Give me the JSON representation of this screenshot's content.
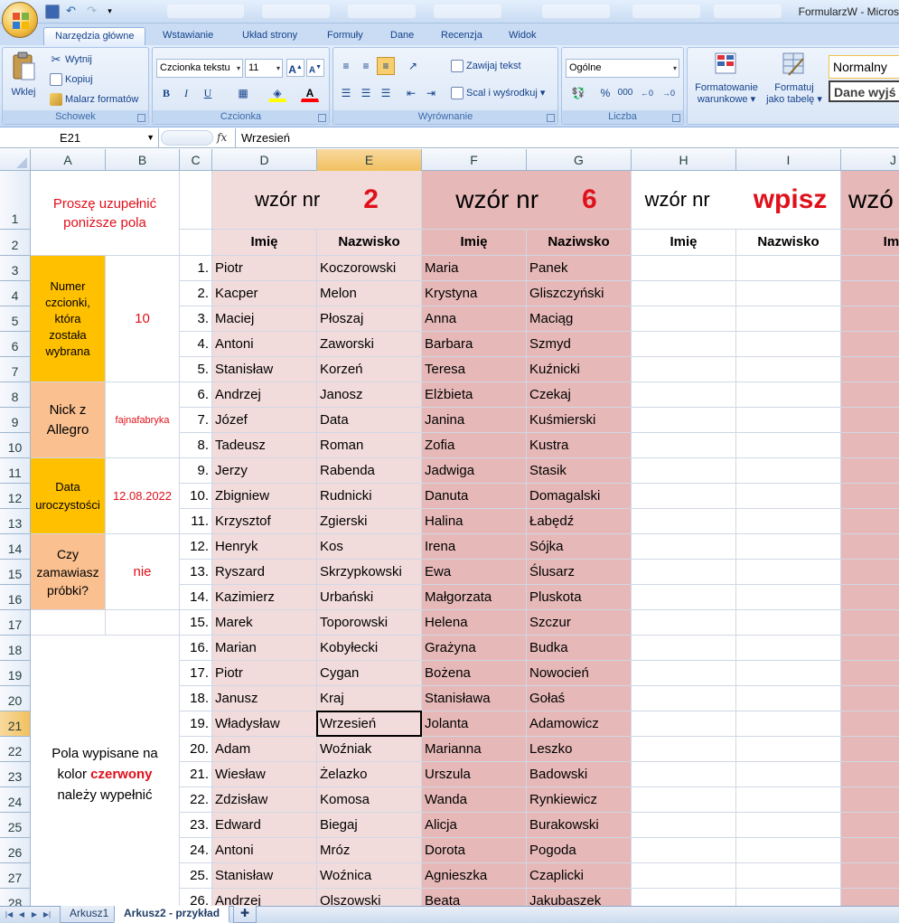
{
  "window": {
    "title": "FormularzW - Micros"
  },
  "ribbon_tabs": [
    "Narzędzia główne",
    "Wstawianie",
    "Układ strony",
    "Formuły",
    "Dane",
    "Recenzja",
    "Widok"
  ],
  "ribbon": {
    "clipboard": {
      "paste": "Wklej",
      "cut": "Wytnij",
      "copy": "Kopiuj",
      "format_painter": "Malarz formatów",
      "label": "Schowek"
    },
    "font": {
      "font_name": "Czcionka tekstu",
      "font_size": "11",
      "label": "Czcionka"
    },
    "alignment": {
      "wrap_text": "Zawijaj tekst",
      "merge_center": "Scal i wyśrodkuj",
      "label": "Wyrównanie"
    },
    "number": {
      "format": "Ogólne",
      "label": "Liczba"
    },
    "styles": {
      "conditional_line1": "Formatowanie",
      "conditional_line2": "warunkowe",
      "table_line1": "Formatuj",
      "table_line2": "jako tabelę",
      "style_normal": "Normalny",
      "style_output": "Dane wyjś"
    }
  },
  "formula_bar": {
    "name_box": "E21",
    "fx": "fx",
    "content": "Wrzesień"
  },
  "columns": [
    "A",
    "B",
    "C",
    "D",
    "E",
    "F",
    "G",
    "H",
    "I",
    "J"
  ],
  "rows": [
    "1",
    "2",
    "3",
    "4",
    "5",
    "6",
    "7",
    "8",
    "9",
    "10",
    "11",
    "12",
    "13",
    "14",
    "15",
    "16",
    "17",
    "18",
    "19",
    "20",
    "21",
    "22",
    "23",
    "24",
    "25",
    "26",
    "27",
    "28"
  ],
  "form": {
    "instruction_line1": "Proszę uzupełnić",
    "instruction_line2": "poniższe pola",
    "font_number_label": [
      "Numer",
      "czcionki,",
      "która",
      "została",
      "wybrana"
    ],
    "font_number_value": "10",
    "nick_label": [
      "Nick z",
      "Allegro"
    ],
    "nick_value": "fajnafabryka",
    "date_label": [
      "Data",
      "uroczystości"
    ],
    "date_value": "12.08.2022",
    "samples_label": [
      "Czy",
      "zamawiasz",
      "próbki?"
    ],
    "samples_value": "nie",
    "note_line1": "Pola wypisane na",
    "note_line2a": "kolor ",
    "note_line2b": "czerwony",
    "note_line3": "należy wypełnić"
  },
  "patterns": {
    "p1_label": "wzór nr",
    "p1_number": "2",
    "p2_label": "wzór nr",
    "p2_number": "6",
    "p3_label": "wzór nr",
    "p3_number": "wpisz",
    "p4_label": "wzó"
  },
  "table_headers": {
    "first_name": "Imię",
    "last_name": "Nazwisko",
    "last_name_alt": "Naziwsko",
    "first_name_cut": "Imi"
  },
  "guests": [
    {
      "n": "1.",
      "d": "Piotr",
      "e": "Koczorowski",
      "f": "Maria",
      "g": "Panek"
    },
    {
      "n": "2.",
      "d": "Kacper",
      "e": "Melon",
      "f": "Krystyna",
      "g": "Gliszczyński"
    },
    {
      "n": "3.",
      "d": "Maciej",
      "e": "Płoszaj",
      "f": "Anna",
      "g": "Maciąg"
    },
    {
      "n": "4.",
      "d": "Antoni",
      "e": "Zaworski",
      "f": "Barbara",
      "g": "Szmyd"
    },
    {
      "n": "5.",
      "d": "Stanisław",
      "e": "Korzeń",
      "f": "Teresa",
      "g": "Kuźnicki"
    },
    {
      "n": "6.",
      "d": "Andrzej",
      "e": "Janosz",
      "f": "Elżbieta",
      "g": "Czekaj"
    },
    {
      "n": "7.",
      "d": "Józef",
      "e": "Data",
      "f": "Janina",
      "g": "Kuśmierski"
    },
    {
      "n": "8.",
      "d": "Tadeusz",
      "e": "Roman",
      "f": "Zofia",
      "g": "Kustra"
    },
    {
      "n": "9.",
      "d": "Jerzy",
      "e": "Rabenda",
      "f": "Jadwiga",
      "g": "Stasik"
    },
    {
      "n": "10.",
      "d": "Zbigniew",
      "e": "Rudnicki",
      "f": "Danuta",
      "g": "Domagalski"
    },
    {
      "n": "11.",
      "d": "Krzysztof",
      "e": "Zgierski",
      "f": "Halina",
      "g": "Łabędź"
    },
    {
      "n": "12.",
      "d": "Henryk",
      "e": "Kos",
      "f": "Irena",
      "g": "Sójka"
    },
    {
      "n": "13.",
      "d": "Ryszard",
      "e": "Skrzypkowski",
      "f": "Ewa",
      "g": "Ślusarz"
    },
    {
      "n": "14.",
      "d": "Kazimierz",
      "e": "Urbański",
      "f": "Małgorzata",
      "g": "Pluskota"
    },
    {
      "n": "15.",
      "d": "Marek",
      "e": "Toporowski",
      "f": "Helena",
      "g": "Szczur"
    },
    {
      "n": "16.",
      "d": "Marian",
      "e": "Kobyłecki",
      "f": "Grażyna",
      "g": "Budka"
    },
    {
      "n": "17.",
      "d": "Piotr",
      "e": "Cygan",
      "f": "Bożena",
      "g": "Nowocień"
    },
    {
      "n": "18.",
      "d": "Janusz",
      "e": "Kraj",
      "f": "Stanisława",
      "g": "Gołaś"
    },
    {
      "n": "19.",
      "d": "Władysław",
      "e": "Wrzesień",
      "f": "Jolanta",
      "g": "Adamowicz"
    },
    {
      "n": "20.",
      "d": "Adam",
      "e": "Woźniak",
      "f": "Marianna",
      "g": "Leszko"
    },
    {
      "n": "21.",
      "d": "Wiesław",
      "e": "Żelazko",
      "f": "Urszula",
      "g": "Badowski"
    },
    {
      "n": "22.",
      "d": "Zdzisław",
      "e": "Komosa",
      "f": "Wanda",
      "g": "Rynkiewicz"
    },
    {
      "n": "23.",
      "d": "Edward",
      "e": "Biegaj",
      "f": "Alicja",
      "g": "Burakowski"
    },
    {
      "n": "24.",
      "d": "Antoni",
      "e": "Mróz",
      "f": "Dorota",
      "g": "Pogoda"
    },
    {
      "n": "25.",
      "d": "Stanisław",
      "e": "Woźnica",
      "f": "Agnieszka",
      "g": "Czaplicki"
    },
    {
      "n": "26.",
      "d": "Andrzej",
      "e": "Olszowski",
      "f": "Beata",
      "g": "Jakubaszek"
    }
  ],
  "sheet_tabs": [
    "Arkusz1",
    "Arkusz2 - przykład"
  ],
  "colors": {
    "accent_red": "#e0101a",
    "orange_dark": "#ffc000",
    "orange_light": "#fac090",
    "pink_light": "#f2dcdb",
    "pink_dark": "#e6b9b8"
  }
}
